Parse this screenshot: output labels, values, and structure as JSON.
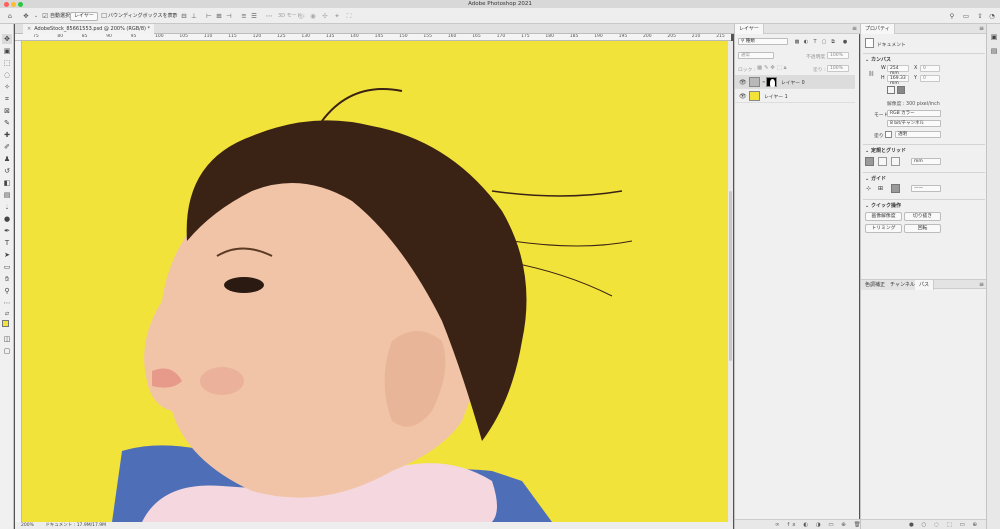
{
  "window": {
    "title": "Adobe Photoshop 2021"
  },
  "options_bar": {
    "auto_select_label": "自動選択",
    "target_value": "レイヤー",
    "bounding_box_label": "バウンディングボックスを表示",
    "mode_3d_label": "3D モード :"
  },
  "document": {
    "tab_title": "AdobeStock_85661553.psd @ 200% (RGB/8) *",
    "zoom": "200%",
    "status": "ドキュメント : 17.9M/17.9M"
  },
  "ruler": {
    "h_ticks": [
      "75",
      "80",
      "85",
      "90",
      "95",
      "100",
      "105",
      "110",
      "115",
      "120",
      "125",
      "130",
      "135",
      "140",
      "145",
      "150",
      "155",
      "160",
      "165",
      "170",
      "175",
      "180",
      "185",
      "190",
      "195",
      "200",
      "205",
      "210",
      "215"
    ]
  },
  "layers_panel": {
    "tabs": [
      "レイヤー"
    ],
    "filter_label": "種類",
    "blend_mode": "通常",
    "opacity_label": "不透明度 :",
    "opacity_value": "100%",
    "lock_label": "ロック :",
    "fill_label": "塗り :",
    "fill_value": "100%",
    "layers": [
      {
        "name": "レイヤー 0",
        "selected": true
      },
      {
        "name": "レイヤー 1",
        "selected": false
      }
    ]
  },
  "properties_panel": {
    "tab": "プロパティ",
    "doc_label": "ドキュメント",
    "canvas_section": "カンバス",
    "width_label": "W",
    "width_value": "254 mm",
    "height_label": "H",
    "height_value": "169.33 mm",
    "x_label": "X",
    "y_label": "Y",
    "x_value": "0",
    "y_value": "0",
    "resolution": "解像度 : 300 pixel/inch",
    "mode_label": "モード",
    "mode_value": "RGB カラー",
    "depth_value": "8 bit/チャンネル",
    "fill_label": "塗り",
    "fill_value": "透明",
    "rulers_grid_section": "定規とグリッド",
    "ruler_unit": "mm",
    "guides_section": "ガイド",
    "quick_actions_section": "クイック操作",
    "buttons": [
      "画像解像度",
      "切り抜き",
      "トリミング",
      "回転"
    ],
    "bottom_tabs": [
      "色調補正",
      "チャンネル",
      "パス"
    ]
  },
  "colors": {
    "canvas_bg": "#f2e33b",
    "foreground_swatch": "#f2e33b"
  }
}
